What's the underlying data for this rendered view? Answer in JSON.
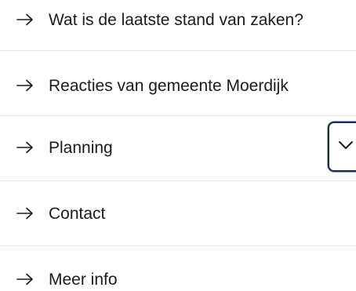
{
  "menu": {
    "items": [
      {
        "label": "Wat is de laatste stand van zaken?",
        "icon": "arrow-right-icon"
      },
      {
        "label": "Reacties van gemeente Moerdijk",
        "icon": "arrow-right-icon"
      },
      {
        "label": "Planning",
        "icon": "arrow-right-icon"
      },
      {
        "label": "Contact",
        "icon": "arrow-right-icon"
      },
      {
        "label": "Meer info",
        "icon": "arrow-right-icon"
      }
    ],
    "toggle_icon": "chevron-down-icon"
  },
  "colors": {
    "text": "#1b1b1b",
    "divider": "#e6e6e6",
    "focus_border": "#1c2b4a",
    "focus_ring": "#8aa6d8"
  }
}
